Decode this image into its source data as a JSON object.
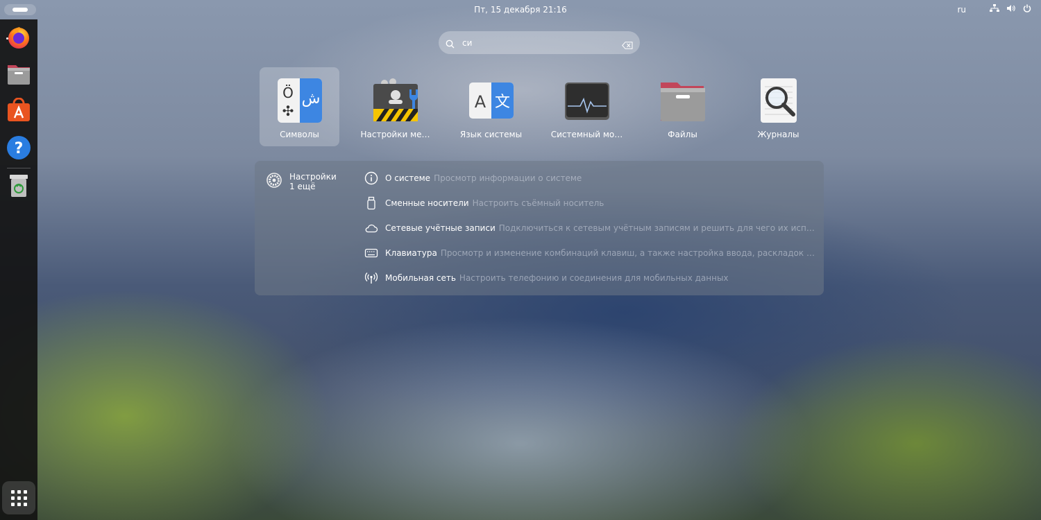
{
  "topbar": {
    "datetime": "Пт, 15 декабря  21:16",
    "language": "ru",
    "icons": [
      "network-icon",
      "volume-icon",
      "power-icon"
    ]
  },
  "dock": {
    "items": [
      {
        "name": "firefox",
        "icon": "firefox-icon"
      },
      {
        "name": "files",
        "icon": "files-icon"
      },
      {
        "name": "app-center",
        "icon": "app-center-icon"
      },
      {
        "name": "help",
        "icon": "help-icon"
      },
      {
        "name": "trash",
        "icon": "trash-icon"
      }
    ],
    "show_apps_icon": "grid-icon"
  },
  "search": {
    "value": "си",
    "placeholder": ""
  },
  "apps": [
    {
      "label": "Символы",
      "icon": "characters-icon",
      "selected": true
    },
    {
      "label": "Настройки ме…",
      "icon": "settings-manager-icon",
      "selected": false
    },
    {
      "label": "Язык системы",
      "icon": "language-icon",
      "selected": false
    },
    {
      "label": "Системный мо…",
      "icon": "system-monitor-icon",
      "selected": false
    },
    {
      "label": "Файлы",
      "icon": "files-icon",
      "selected": false
    },
    {
      "label": "Журналы",
      "icon": "logs-icon",
      "selected": false
    }
  ],
  "results": {
    "provider": {
      "name": "Настройки",
      "more": "1 ещё",
      "icon": "settings-gear-icon"
    },
    "items": [
      {
        "title": "О системе",
        "desc": "Просмотр информации о системе",
        "icon": "info-icon"
      },
      {
        "title": "Сменные носители",
        "desc": "Настроить съёмный носитель",
        "icon": "removable-media-icon"
      },
      {
        "title": "Сетевые учётные записи",
        "desc": "Подключиться к сетевым учётным записям и решить для чего их использовать",
        "icon": "cloud-icon"
      },
      {
        "title": "Клавиатура",
        "desc": "Просмотр и изменение комбинаций клавиш, а также настройка ввода, раскладок клавиатуры и …",
        "icon": "keyboard-icon"
      },
      {
        "title": "Мобильная сеть",
        "desc": "Настроить телефонию и соединения для мобильных данных",
        "icon": "mobile-network-icon"
      }
    ]
  },
  "colors": {
    "dock_bg": "#141414",
    "ubuntu_orange": "#e95420",
    "help_blue": "#2a7de1"
  }
}
